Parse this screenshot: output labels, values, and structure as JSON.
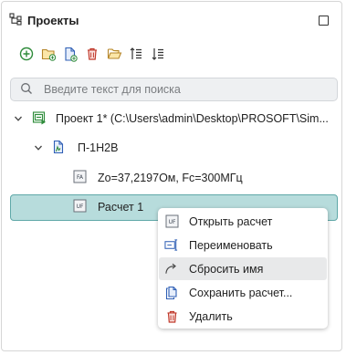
{
  "panel": {
    "title": "Проекты",
    "icons": {
      "panel": "structure-icon",
      "maximize": "maximize-icon"
    }
  },
  "toolbar": {
    "buttons": [
      {
        "icon": "add-circle-icon",
        "color": "#2e8b3a"
      },
      {
        "icon": "add-folder-icon",
        "color": "#c9962a"
      },
      {
        "icon": "add-file-icon",
        "color": "#2f5fb5"
      },
      {
        "icon": "delete-icon",
        "color": "#c0392b"
      },
      {
        "icon": "open-folder-icon",
        "color": "#c9962a"
      },
      {
        "icon": "sort-ascending-icon",
        "color": "#333333"
      },
      {
        "icon": "sort-descending-icon",
        "color": "#333333"
      }
    ]
  },
  "search": {
    "placeholder": "Введите текст для поиска",
    "value": ""
  },
  "tree": {
    "project": {
      "label": "Проект 1* (C:\\Users\\admin\\Desktop\\PROSOFT\\Sim..."
    },
    "element": {
      "label": "П-1Н2В"
    },
    "parameter": {
      "badge": "FA",
      "label": "Zo=37,2197Ом, Fc=300МГц"
    },
    "calculation": {
      "badge": "UF",
      "label": "Расчет 1"
    }
  },
  "context_menu": {
    "items": [
      {
        "label": "Открыть расчет",
        "icon": "uf-badge-icon",
        "badge": "UF"
      },
      {
        "label": "Переименовать",
        "icon": "rename-icon"
      },
      {
        "label": "Сбросить имя",
        "icon": "reset-arrow-icon",
        "highlighted": true
      },
      {
        "label": "Сохранить расчет...",
        "icon": "save-icon"
      },
      {
        "label": "Удалить",
        "icon": "delete-icon"
      }
    ]
  },
  "colors": {
    "selection_bg": "#b7dcdc",
    "selection_border": "#5fa8a8",
    "menu_hover": "#e8e9ea",
    "accent_green": "#2e8b3a",
    "danger_red": "#c0392b"
  }
}
